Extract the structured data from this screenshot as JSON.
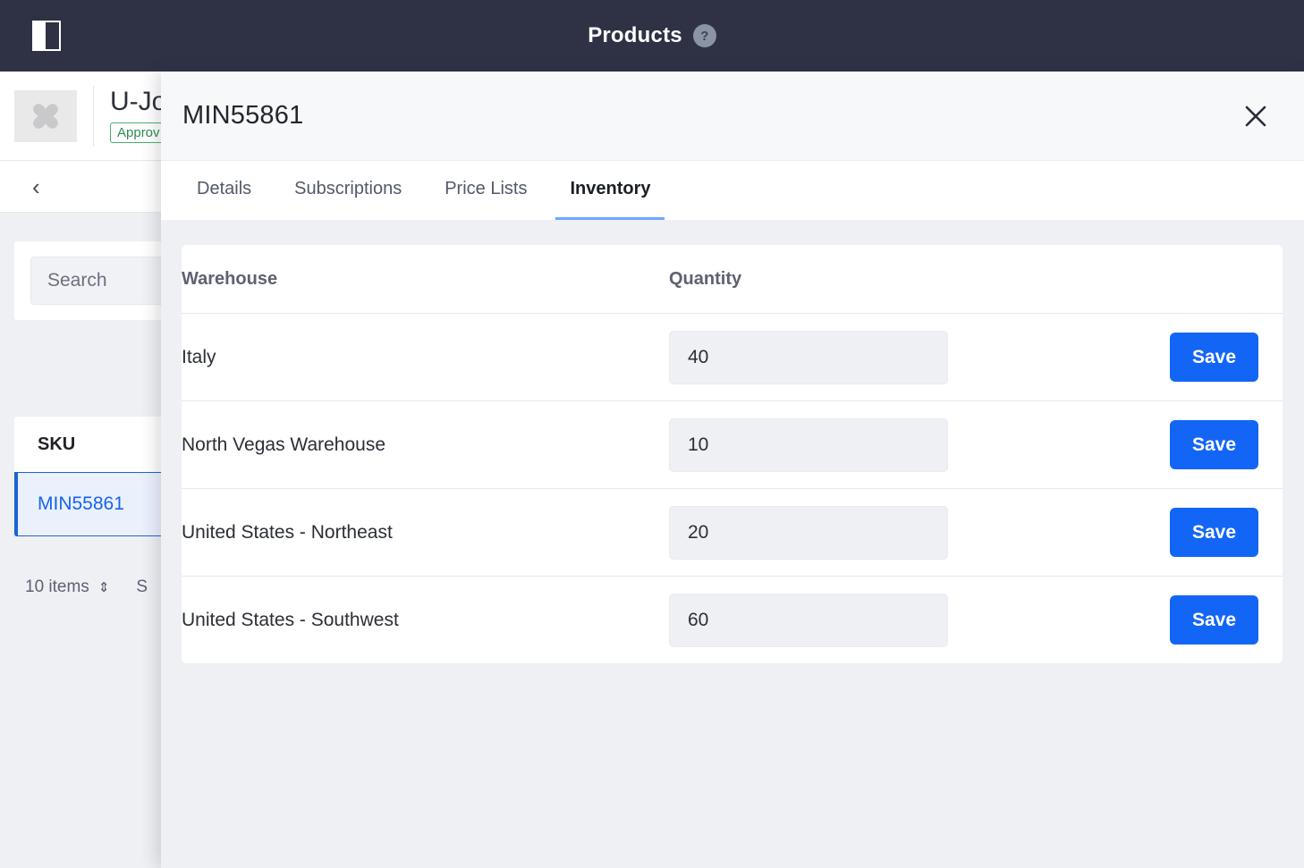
{
  "topbar": {
    "title": "Products",
    "help_label": "?",
    "panel_toggle_name": "panel-toggle-icon"
  },
  "background_page": {
    "product": {
      "title": "U-Jo",
      "status": "Approv",
      "thumbnail_icon": "broken-image-icon"
    },
    "back_label": "‹",
    "search": {
      "placeholder": "Search",
      "value": ""
    },
    "list": {
      "column_header": "SKU",
      "selected_sku": "MIN55861",
      "items_count_label": "10 items",
      "sort_glyph": "⇕",
      "secondary_label": "S"
    }
  },
  "modal": {
    "title": "MIN55861",
    "close_label": "✕",
    "tabs": [
      {
        "label": "Details",
        "active": false
      },
      {
        "label": "Subscriptions",
        "active": false
      },
      {
        "label": "Price Lists",
        "active": false
      },
      {
        "label": "Inventory",
        "active": true
      }
    ],
    "inventory": {
      "columns": [
        "Warehouse",
        "Quantity"
      ],
      "action_label": "Save",
      "rows": [
        {
          "warehouse": "Italy",
          "quantity": "40",
          "save_label": "Save"
        },
        {
          "warehouse": "North Vegas Warehouse",
          "quantity": "10",
          "save_label": "Save"
        },
        {
          "warehouse": "United States - Northeast",
          "quantity": "20",
          "save_label": "Save"
        },
        {
          "warehouse": "United States - Southwest",
          "quantity": "60",
          "save_label": "Save"
        }
      ]
    }
  },
  "colors": {
    "topbar_bg": "#2e3244",
    "accent_blue": "#1366f5",
    "tab_underline": "#6ea8fe",
    "selected_row_bg": "#eaf1fd",
    "selected_row_border": "#1b62d6",
    "status_green": "#2e8b52",
    "page_bg": "#eff0f4"
  }
}
